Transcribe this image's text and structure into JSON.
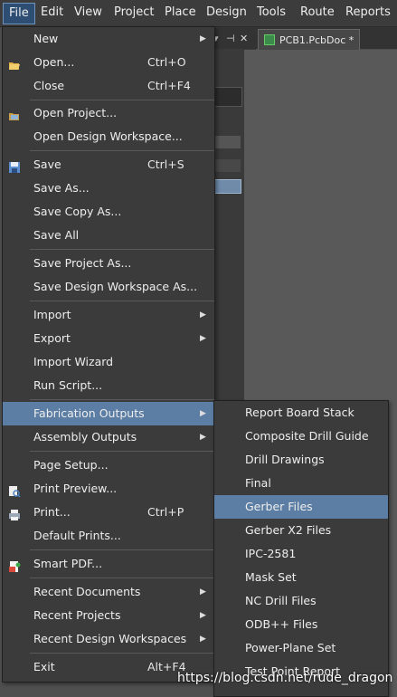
{
  "menubar": {
    "items": [
      "File",
      "Edit",
      "View",
      "Project",
      "Place",
      "Design",
      "Tools",
      "Route",
      "Reports"
    ]
  },
  "document": {
    "tab_label": "PCB1.PcbDoc *",
    "panel_controls": [
      "▾",
      "⊣",
      "✕"
    ]
  },
  "file_menu": {
    "items": [
      {
        "label": "New",
        "shortcut": "",
        "submenu": true,
        "icon": ""
      },
      {
        "label": "Open...",
        "shortcut": "Ctrl+O",
        "submenu": false,
        "icon": "open-folder-icon"
      },
      {
        "label": "Close",
        "shortcut": "Ctrl+F4",
        "submenu": false,
        "icon": ""
      },
      {
        "label": "Open Project...",
        "shortcut": "",
        "submenu": false,
        "icon": "open-project-icon"
      },
      {
        "label": "Open Design Workspace...",
        "shortcut": "",
        "submenu": false,
        "icon": ""
      },
      {
        "label": "Save",
        "shortcut": "Ctrl+S",
        "submenu": false,
        "icon": "save-disk-icon"
      },
      {
        "label": "Save As...",
        "shortcut": "",
        "submenu": false,
        "icon": ""
      },
      {
        "label": "Save Copy As...",
        "shortcut": "",
        "submenu": false,
        "icon": ""
      },
      {
        "label": "Save All",
        "shortcut": "",
        "submenu": false,
        "icon": ""
      },
      {
        "label": "Save Project As...",
        "shortcut": "",
        "submenu": false,
        "icon": ""
      },
      {
        "label": "Save Design Workspace As...",
        "shortcut": "",
        "submenu": false,
        "icon": ""
      },
      {
        "label": "Import",
        "shortcut": "",
        "submenu": true,
        "icon": ""
      },
      {
        "label": "Export",
        "shortcut": "",
        "submenu": true,
        "icon": ""
      },
      {
        "label": "Import Wizard",
        "shortcut": "",
        "submenu": false,
        "icon": ""
      },
      {
        "label": "Run Script...",
        "shortcut": "",
        "submenu": false,
        "icon": ""
      },
      {
        "label": "Fabrication Outputs",
        "shortcut": "",
        "submenu": true,
        "icon": ""
      },
      {
        "label": "Assembly Outputs",
        "shortcut": "",
        "submenu": true,
        "icon": ""
      },
      {
        "label": "Page Setup...",
        "shortcut": "",
        "submenu": false,
        "icon": ""
      },
      {
        "label": "Print Preview...",
        "shortcut": "",
        "submenu": false,
        "icon": "print-preview-icon"
      },
      {
        "label": "Print...",
        "shortcut": "Ctrl+P",
        "submenu": false,
        "icon": "printer-icon"
      },
      {
        "label": "Default Prints...",
        "shortcut": "",
        "submenu": false,
        "icon": ""
      },
      {
        "label": "Smart PDF...",
        "shortcut": "",
        "submenu": false,
        "icon": "smart-pdf-icon"
      },
      {
        "label": "Recent Documents",
        "shortcut": "",
        "submenu": true,
        "icon": ""
      },
      {
        "label": "Recent Projects",
        "shortcut": "",
        "submenu": true,
        "icon": ""
      },
      {
        "label": "Recent Design Workspaces",
        "shortcut": "",
        "submenu": true,
        "icon": ""
      },
      {
        "label": "Exit",
        "shortcut": "Alt+F4",
        "submenu": false,
        "icon": ""
      }
    ]
  },
  "fabrication_submenu": {
    "items": [
      "Report Board Stack",
      "Composite Drill Guide",
      "Drill Drawings",
      "Final",
      "Gerber Files",
      "Gerber X2 Files",
      "IPC-2581",
      "Mask Set",
      "NC Drill Files",
      "ODB++ Files",
      "Power-Plane Set",
      "Test Point Report"
    ],
    "highlighted": "Gerber Files"
  },
  "watermark": "https://blog.csdn.net/rude_dragon",
  "colors": {
    "highlight": "#5c7ea4",
    "menu_bg": "#3b3b3b",
    "menubar_bg": "#3c3c3c"
  }
}
